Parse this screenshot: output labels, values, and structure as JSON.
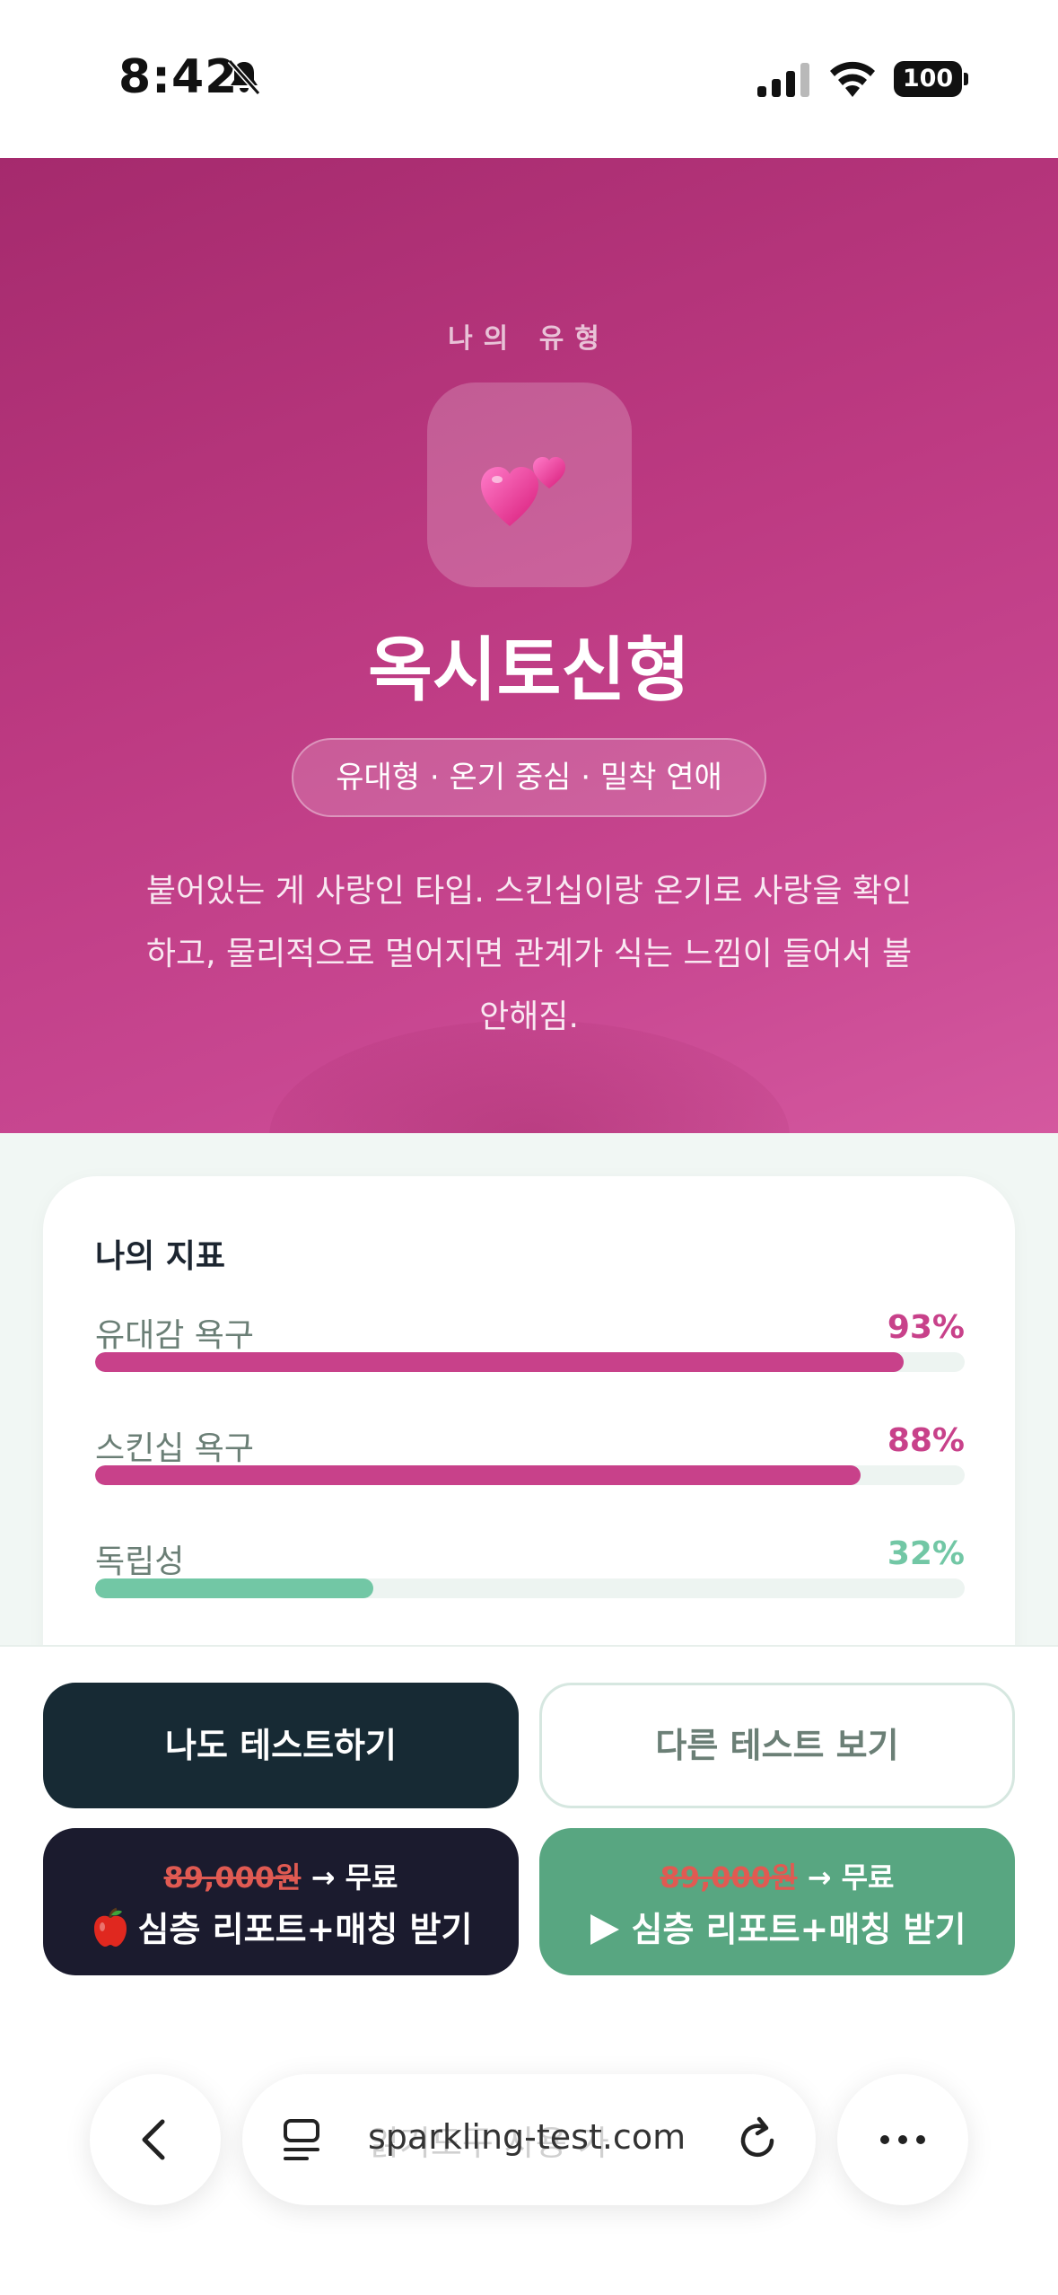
{
  "status_bar": {
    "time": "8:42",
    "battery": "100"
  },
  "hero": {
    "eyebrow": "나의 유형",
    "icon": "two-hearts-icon",
    "title": "옥시토신형",
    "tag": "유대형 · 온기 중심 · 밀착 연애",
    "description": "붙어있는 게 사랑인 타입. 스킨십이랑 온기로 사랑을 확인하고, 물리적으로 멀어지면 관계가 식는 느낌이 들어서 불안해짐.",
    "colors": {
      "start": "#a52a6d",
      "end": "#d4589f"
    }
  },
  "metrics": {
    "title": "나의 지표",
    "items": [
      {
        "label": "유대감 욕구",
        "value": "93%",
        "percent": 93,
        "color": "#c8418a"
      },
      {
        "label": "스킨십 욕구",
        "value": "88%",
        "percent": 88,
        "color": "#c8418a"
      },
      {
        "label": "독립성",
        "value": "32%",
        "percent": 32,
        "color": "#72c7a5"
      }
    ]
  },
  "actions": {
    "try_test": "나도 테스트하기",
    "other_tests": "다른 테스트 보기",
    "report_ios": {
      "old_price": "89,000원",
      "price_suffix": " → 무료",
      "label": "심층 리포트+매칭 받기",
      "icon": "apple-icon"
    },
    "report_android": {
      "old_price": "89,000원",
      "price_suffix": " → 무료",
      "label": "심층 리포트+매칭 받기",
      "icon": "play-icon"
    }
  },
  "browser": {
    "url": "sparkling-test.com",
    "ghost_text": "읽기도구 사용 가"
  }
}
